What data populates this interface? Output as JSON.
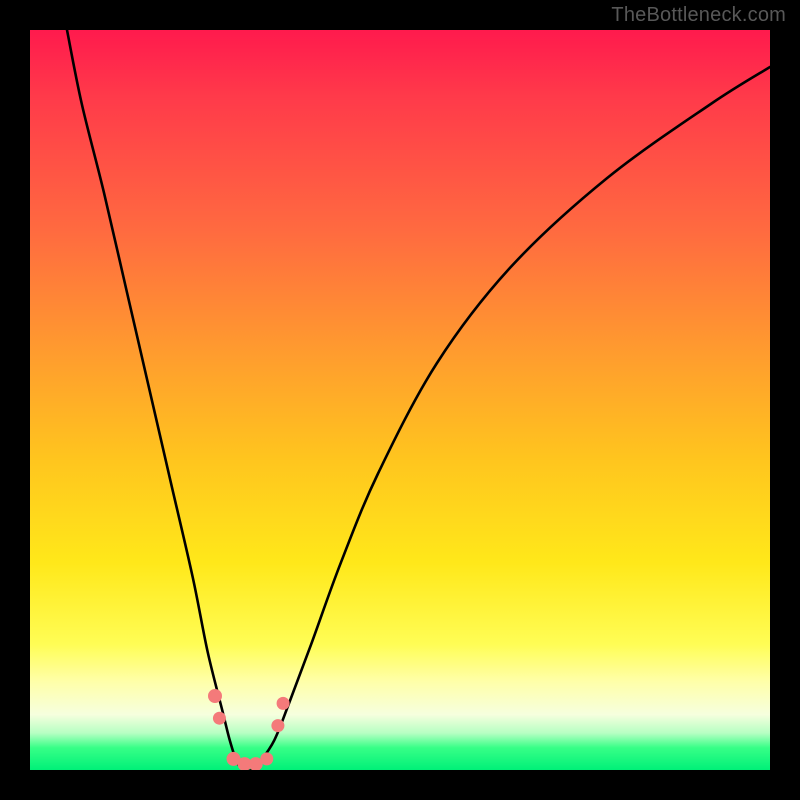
{
  "watermark": "TheBottleneck.com",
  "chart_data": {
    "type": "line",
    "title": "",
    "xlabel": "",
    "ylabel": "",
    "xlim": [
      0,
      100
    ],
    "ylim": [
      0,
      100
    ],
    "grid": false,
    "legend": false,
    "background_gradient": {
      "direction": "vertical",
      "stops": [
        {
          "pos": 0,
          "color": "#ff1a4d"
        },
        {
          "pos": 0.27,
          "color": "#ff6a40"
        },
        {
          "pos": 0.58,
          "color": "#ffc51e"
        },
        {
          "pos": 0.83,
          "color": "#fffd55"
        },
        {
          "pos": 0.93,
          "color": "#f6ffde"
        },
        {
          "pos": 1.0,
          "color": "#00f078"
        }
      ]
    },
    "series": [
      {
        "name": "bottleneck-curve",
        "color": "#000000",
        "x": [
          5,
          7,
          10,
          13,
          16,
          19,
          22,
          24,
          26,
          27,
          28,
          29,
          30,
          31,
          33,
          35,
          38,
          42,
          47,
          55,
          65,
          78,
          92,
          100
        ],
        "values": [
          100,
          90,
          78,
          65,
          52,
          39,
          26,
          16,
          8,
          4,
          1,
          0,
          0,
          1,
          4,
          9,
          17,
          28,
          40,
          55,
          68,
          80,
          90,
          95
        ]
      }
    ],
    "markers": [
      {
        "name": "cluster-left-upper",
        "x": 25.0,
        "y": 10,
        "color": "#f47a7a",
        "size": 14
      },
      {
        "name": "cluster-left-upper2",
        "x": 25.6,
        "y": 7,
        "color": "#f47a7a",
        "size": 13
      },
      {
        "name": "cluster-bottom-1",
        "x": 27.5,
        "y": 1.5,
        "color": "#f47a7a",
        "size": 14
      },
      {
        "name": "cluster-bottom-2",
        "x": 29.0,
        "y": 0.8,
        "color": "#f47a7a",
        "size": 14
      },
      {
        "name": "cluster-bottom-3",
        "x": 30.5,
        "y": 0.8,
        "color": "#f47a7a",
        "size": 14
      },
      {
        "name": "cluster-bottom-4",
        "x": 32.0,
        "y": 1.5,
        "color": "#f47a7a",
        "size": 13
      },
      {
        "name": "cluster-right-1",
        "x": 33.5,
        "y": 6,
        "color": "#f47a7a",
        "size": 13
      },
      {
        "name": "cluster-right-2",
        "x": 34.2,
        "y": 9,
        "color": "#f47a7a",
        "size": 13
      }
    ]
  }
}
